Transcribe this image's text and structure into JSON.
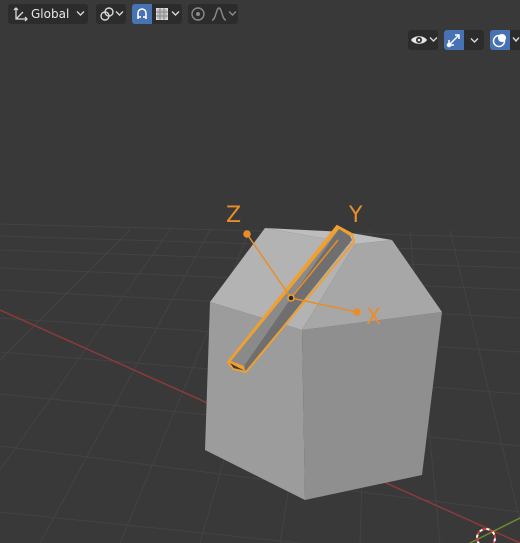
{
  "header": {
    "transform_orientation": {
      "value": "Global",
      "icon": "transform-orientation-icon"
    },
    "pivot_point": {
      "icon": "pivot-link-icon"
    },
    "snap": {
      "icon": "snap-magnet-icon",
      "active": true
    },
    "snap_target": {
      "icon": "snap-increment-icon"
    },
    "proportional_editing": {
      "icon": "proportional-editing-icon",
      "active": false
    },
    "falloff": {
      "icon": "falloff-curve-icon"
    },
    "visibility": {
      "icon": "eye-icon"
    },
    "gizmos": {
      "icon": "gizmo-icon",
      "active": true
    },
    "overlays": {
      "icon": "overlays-icon",
      "active": true
    }
  },
  "viewport": {
    "background": "#393939",
    "grid_color": "#454545",
    "x_axis_color": "#8c3a3a",
    "y_axis_color": "#6b8b2e",
    "object_color": "#a2a2a2",
    "selection_color": "#f0a030",
    "gizmo_labels": {
      "z": "Z",
      "y": "Y",
      "x": "X"
    }
  }
}
